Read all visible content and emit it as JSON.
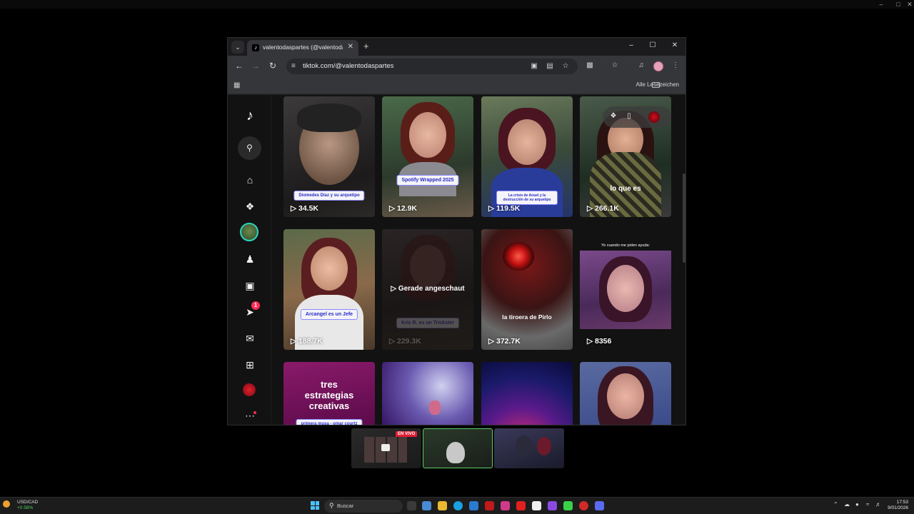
{
  "browser": {
    "tab_title": "valentodaspartes (@valentoda",
    "url": "tiktok.com/@valentodaspartes",
    "bookmarks_all_label": "Alle Lesezeichen"
  },
  "sidebar": {
    "notification_count": "1"
  },
  "videos": [
    {
      "views": "34.5K",
      "caption": "Diomedes Díaz y su arquetipo"
    },
    {
      "views": "12.9K",
      "caption": "Spotify Wrapped 2025"
    },
    {
      "views": "119.5K",
      "caption": "La crisis de Anuel y la destrucción de su arquetipo"
    },
    {
      "views": "266.1K",
      "caption": "lo que es"
    },
    {
      "views": "188.7K",
      "caption": "Arcangel es un Jefe"
    },
    {
      "views": "229.3K",
      "caption": "Kris R. es un Trickster",
      "overlay": "Gerade angeschaut"
    },
    {
      "views": "372.7K",
      "caption": "la tiroera de Pirlo"
    },
    {
      "views": "8356",
      "caption": "Yo cuando me piden ayuda:"
    },
    {
      "views": "",
      "caption": "tres estrategias creativas",
      "subcaption": "primera musa - omar courtz"
    },
    {
      "views": "",
      "caption": ""
    },
    {
      "views": "",
      "caption": ""
    },
    {
      "views": "",
      "caption": ""
    }
  ],
  "stream": {
    "live_badge": "EN VIVO"
  },
  "taskbar": {
    "stock_symbol": "USD/CAD",
    "stock_change": "+0.58%",
    "search_placeholder": "Buscar",
    "time": "17:53",
    "date": "9/01/2026"
  }
}
